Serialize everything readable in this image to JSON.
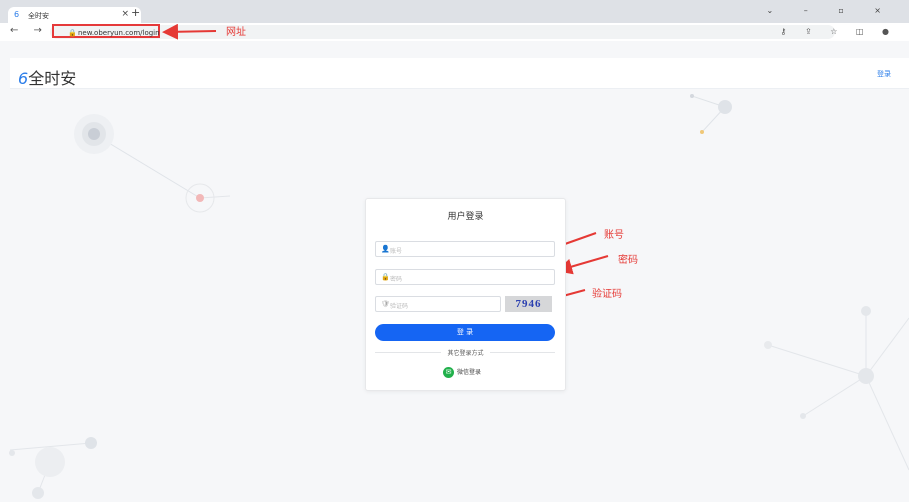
{
  "browser": {
    "tab_title": "全时安",
    "tab_favicon": "6",
    "url": "new.oberyun.com/login",
    "window_controls": "⌄ – ▫ ×",
    "nav_glyphs": "← → C",
    "tool_glyphs": "⚷ ⇪ ☆ ◫ ●"
  },
  "header": {
    "logo_mark": "6",
    "logo_text": "全时安",
    "login_link": "登录"
  },
  "login": {
    "title": "用户登录",
    "account_placeholder": "账号",
    "password_placeholder": "密码",
    "captcha_placeholder": "验证码",
    "captcha_text": "7946",
    "submit_label": "登 录",
    "other_methods": "其它登录方式",
    "wechat_label": "微信登录"
  },
  "annotations": {
    "url": "网址",
    "account": "账号",
    "password": "密码",
    "captcha": "验证码"
  },
  "colors": {
    "accent": "#1565f3",
    "annotation": "#e53935",
    "wechat": "#21b04b"
  }
}
